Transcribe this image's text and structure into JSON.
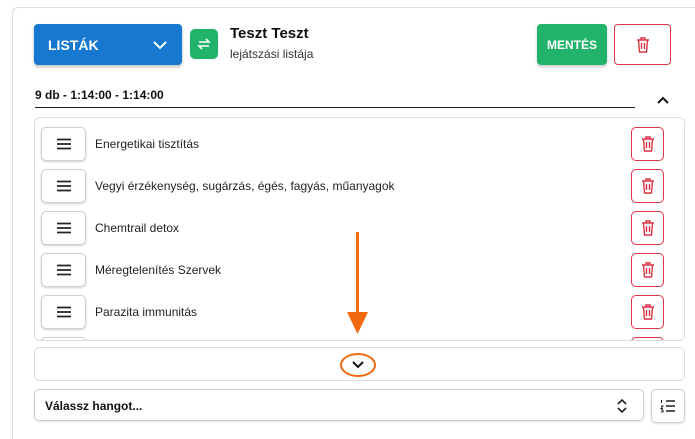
{
  "header": {
    "lists_button": "LISTÁK",
    "title": "Teszt Teszt",
    "subtitle": "lejátszási listája",
    "save_button": "MENTÉS"
  },
  "summary": {
    "text": "9 db - 1:14:00 - 1:14:00"
  },
  "items": [
    {
      "label": "Energetikai tisztítás"
    },
    {
      "label": "Vegyi érzékenység, sugárzás, égés, fagyás, műanyagok"
    },
    {
      "label": "Chemtrail detox"
    },
    {
      "label": "Méregtelenítés Szervek"
    },
    {
      "label": "Parazita immunitás"
    }
  ],
  "sound_select": {
    "value": "Válassz hangot..."
  },
  "icons": {
    "lists_dropdown": "chevron-down-icon",
    "swap": "swap-icon",
    "delete": "trash-icon",
    "drag": "hamburger-icon",
    "collapse": "chevron-up-icon",
    "expand": "chevron-down-icon",
    "select": "sort-icon",
    "list_order": "numbered-list-icon",
    "annotation": "arrow-down-icon"
  },
  "colors": {
    "primary": "#1679cf",
    "success": "#21b36a",
    "danger": "#dc3545",
    "annotation": "#f26a10"
  }
}
